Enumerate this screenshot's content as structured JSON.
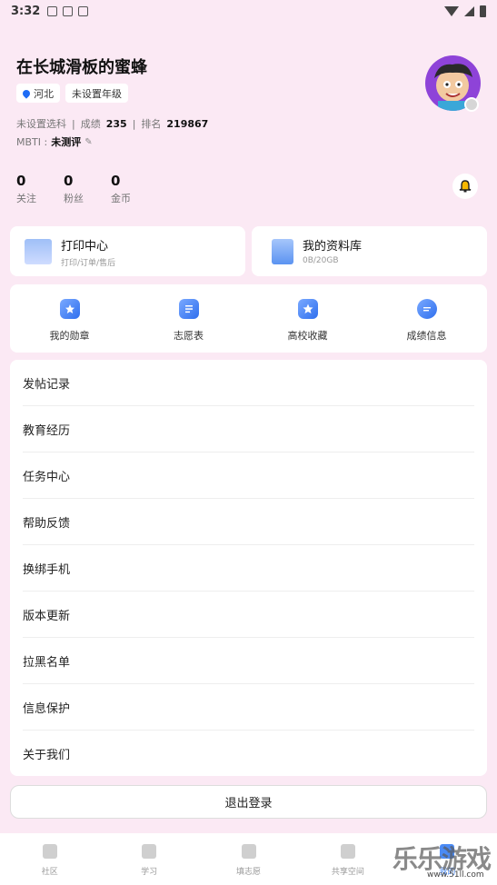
{
  "status_bar": {
    "time": "3:32"
  },
  "profile": {
    "name": "在长城滑板的蜜蜂",
    "location": "河北",
    "grade": "未设置年级",
    "subject": "未设置选科",
    "score_label": "成绩",
    "score": "235",
    "rank_label": "排名",
    "rank": "219867",
    "mbti_label": "MBTI :",
    "mbti_value": "未测评"
  },
  "stats": [
    {
      "value": "0",
      "label": "关注"
    },
    {
      "value": "0",
      "label": "粉丝"
    },
    {
      "value": "0",
      "label": "金币"
    }
  ],
  "cards": {
    "print": {
      "title": "打印中心",
      "subtitle": "打印/订单/售后"
    },
    "library": {
      "title": "我的资料库",
      "subtitle": "0B/20GB"
    }
  },
  "quick_links": [
    {
      "label": "我的勋章",
      "icon": "medal-icon"
    },
    {
      "label": "志愿表",
      "icon": "form-icon"
    },
    {
      "label": "高校收藏",
      "icon": "star-icon"
    },
    {
      "label": "成绩信息",
      "icon": "chat-icon"
    }
  ],
  "menu": [
    "发帖记录",
    "教育经历",
    "任务中心",
    "帮助反馈",
    "换绑手机",
    "版本更新",
    "拉黑名单",
    "信息保护",
    "关于我们"
  ],
  "logout_label": "退出登录",
  "tabs": [
    {
      "label": "社区",
      "icon": "home-icon"
    },
    {
      "label": "学习",
      "icon": "book-icon"
    },
    {
      "label": "填志愿",
      "icon": "form-icon"
    },
    {
      "label": "共享空间",
      "icon": "folder-icon"
    },
    {
      "label": "我的",
      "icon": "user-icon"
    }
  ],
  "watermark": {
    "text": "乐乐游戏",
    "sub": "www.51ll.com"
  }
}
